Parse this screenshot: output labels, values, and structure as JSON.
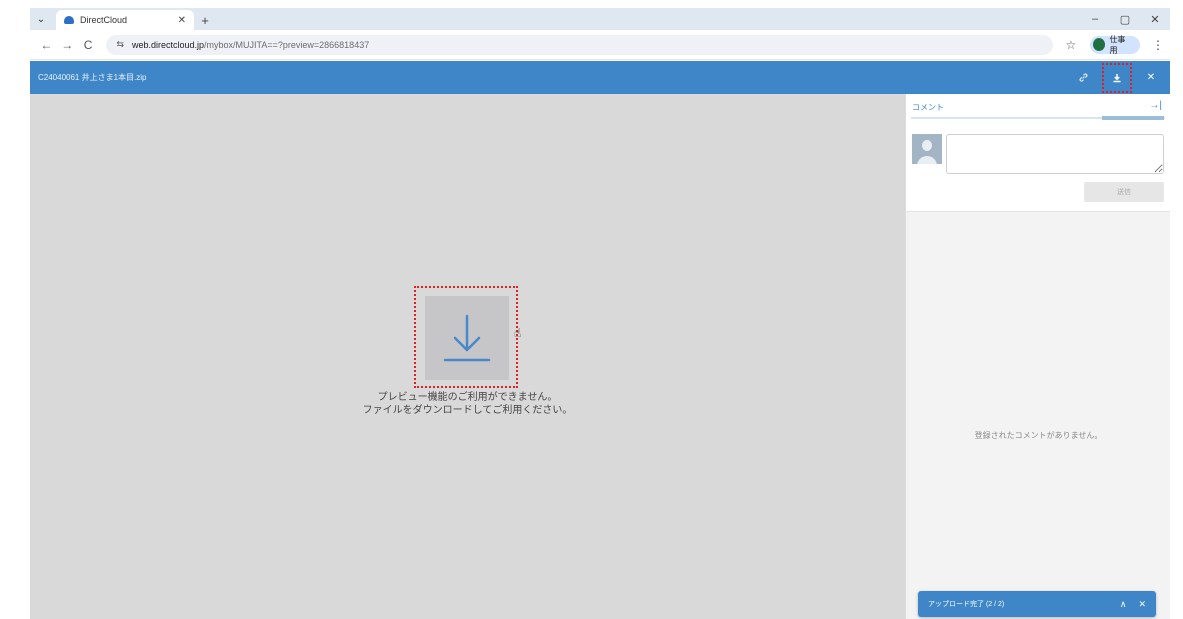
{
  "browser": {
    "tab_title": "DirectCloud",
    "tab_close": "✕",
    "new_tab": "+",
    "menu": "⌄",
    "window_controls": [
      "–",
      "▢",
      "✕"
    ],
    "nav": [
      "←",
      "→",
      "C"
    ],
    "site_icon": "⇆",
    "url_host": "web.directcloud.jp",
    "url_path": "/mybox/MUJITA==?preview=2866818437",
    "bookmark_icon": "☆",
    "profile_label": "仕事用",
    "more_icon": "⋮"
  },
  "header": {
    "filename": "C24040061 井上さま1本目.zip",
    "link_icon": "🔗",
    "download_icon": "⤓",
    "close_icon": "✕"
  },
  "preview": {
    "message_line1": "プレビュー機能のご利用ができません。",
    "message_line2": "ファイルをダウンロードしてご利用ください。",
    "cursor": "☝"
  },
  "comments": {
    "title": "コメント",
    "collapse_icon": "→|",
    "send_label": "送信",
    "empty_text": "登録されたコメントがありません。"
  },
  "upload_toast": {
    "label": "アップロード完了 (2 / 2)",
    "expand_icon": "∧",
    "close_icon": "✕"
  },
  "colors": {
    "header_blue": "#3e86c8",
    "highlight_red": "#e02020",
    "download_arrow": "#4a88c9"
  }
}
